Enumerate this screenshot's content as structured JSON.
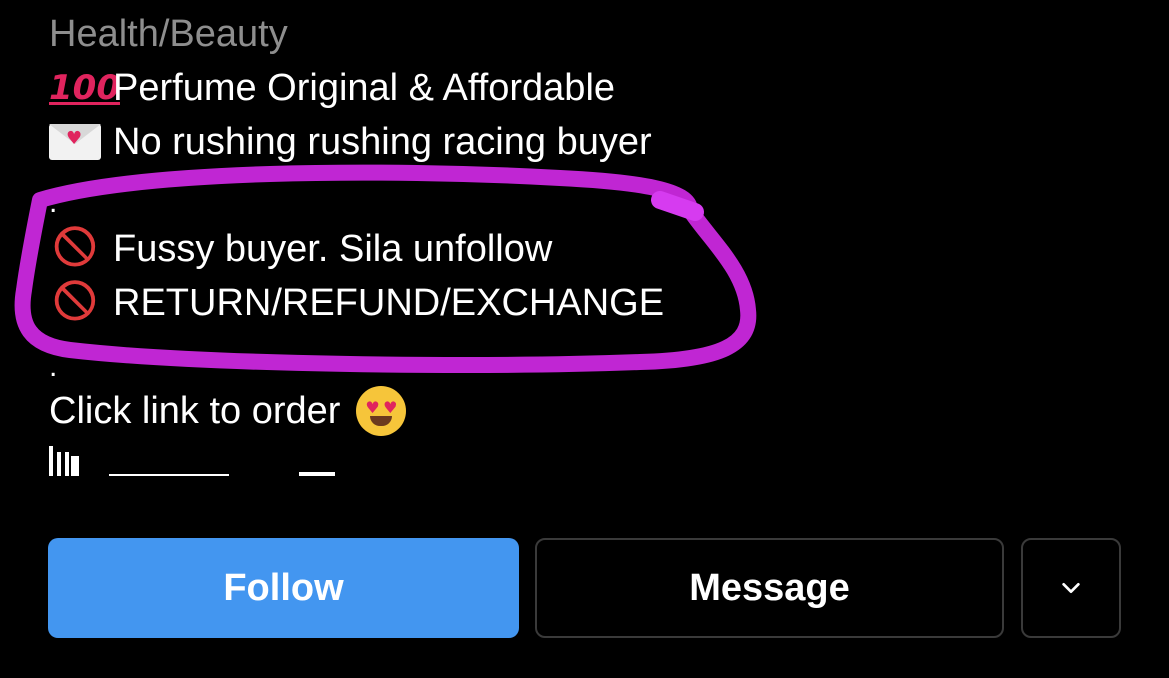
{
  "profile": {
    "category": "Health/Beauty",
    "bio_lines": [
      {
        "icon": "hundred-points-icon",
        "text": "Perfume Original & Affordable"
      },
      {
        "icon": "love-letter-icon",
        "text": "No rushing rushing racing buyer"
      },
      {
        "icon": "",
        "text": "."
      },
      {
        "icon": "prohibited-icon",
        "text": "Fussy buyer. Sila unfollow"
      },
      {
        "icon": "prohibited-icon",
        "text": "RETURN/REFUND/EXCHANGE"
      },
      {
        "icon": "",
        "text": "."
      },
      {
        "icon": "heart-eyes-icon",
        "text": "Click link to order"
      }
    ],
    "hundred_glyph": "100",
    "prohibited_glyph": "🛇",
    "heart_glyph": "♥"
  },
  "actions": {
    "follow_label": "Follow",
    "message_label": "Message"
  },
  "colors": {
    "background": "#000000",
    "text": "#ffffff",
    "category": "#8e8e8e",
    "follow_button": "#4396f0",
    "button_border": "#3a3a3a",
    "highlight_marker": "#c026d3",
    "prohibited": "#e03a3a"
  }
}
